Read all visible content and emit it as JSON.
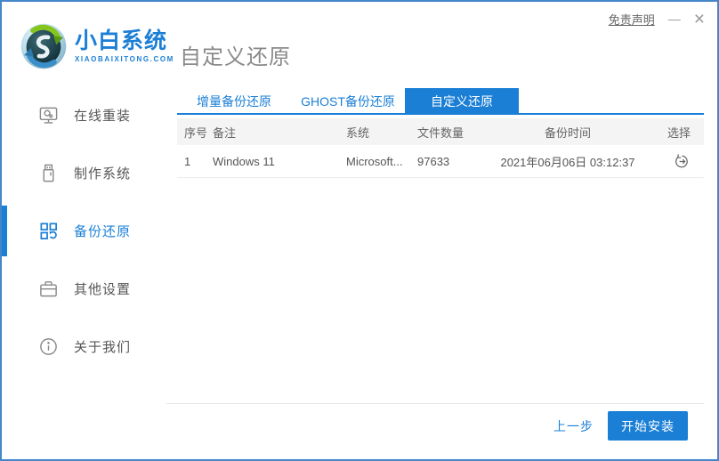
{
  "window": {
    "disclaimer": "免责声明",
    "minimize": "—",
    "close": "×"
  },
  "brand": {
    "name": "小白系统",
    "domain": "XIAOBAIXITONG.COM",
    "logo_icon": "sync-sphere-logo"
  },
  "page": {
    "title": "自定义还原"
  },
  "sidebar": {
    "items": [
      {
        "label": "在线重装",
        "icon": "monitor-icon",
        "active": false
      },
      {
        "label": "制作系统",
        "icon": "usb-drive-icon",
        "active": false
      },
      {
        "label": "备份还原",
        "icon": "backup-grid-icon",
        "active": true
      },
      {
        "label": "其他设置",
        "icon": "briefcase-icon",
        "active": false
      },
      {
        "label": "关于我们",
        "icon": "info-circle-icon",
        "active": false
      }
    ]
  },
  "tabs": [
    {
      "label": "增量备份还原",
      "active": false
    },
    {
      "label": "GHOST备份还原",
      "active": false
    },
    {
      "label": "自定义还原",
      "active": true
    }
  ],
  "table": {
    "headers": [
      "序号",
      "备注",
      "系统",
      "文件数量",
      "备份时间",
      "选择"
    ],
    "rows": [
      {
        "seq": "1",
        "note": "Windows 11",
        "system": "Microsoft...",
        "files": "97633",
        "time": "2021年06月06日 03:12:37",
        "action_icon": "restore-history-icon"
      }
    ]
  },
  "footer": {
    "back": "上一步",
    "install": "开始安装"
  },
  "colors": {
    "accent": "#1b7fd6",
    "window_border": "#4486c9",
    "table_header_bg": "#f4f4f4",
    "text_primary": "#555555",
    "text_muted": "#8a8a8a",
    "row_divider": "#ececec"
  }
}
